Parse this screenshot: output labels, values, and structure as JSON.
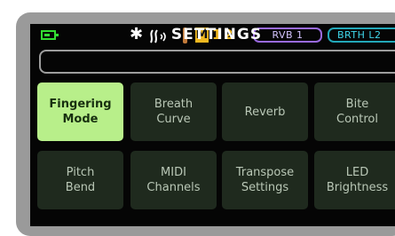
{
  "status_bar": {
    "bluetooth_icon": "bluetooth-icon",
    "breath_icon": "breath-sensor-icon",
    "reed_icon": "reed-icon",
    "mode_letter": "M",
    "mode_values": [
      "1",
      "2"
    ],
    "reverb_pill": "RVB 1",
    "breath_pill": "BRTH L2"
  },
  "header": {
    "title": "SETTINGS"
  },
  "tiles": [
    {
      "label": "Fingering\nMode",
      "active": true
    },
    {
      "label": "Breath\nCurve",
      "active": false
    },
    {
      "label": "Reverb",
      "active": false
    },
    {
      "label": "Bite\nControl",
      "active": false
    },
    {
      "label": "Pitch\nBend",
      "active": false
    },
    {
      "label": "MIDI\nChannels",
      "active": false
    },
    {
      "label": "Transpose\nSettings",
      "active": false
    },
    {
      "label": "LED\nBrightness",
      "active": false
    }
  ],
  "colors": {
    "battery": "#33dd33",
    "active_tile": "#b8ef8a",
    "tile": "#1f2a1e",
    "mode": "#f0b820",
    "reverb_pill": "#9a6ae0",
    "breath_pill": "#22a7b8"
  }
}
